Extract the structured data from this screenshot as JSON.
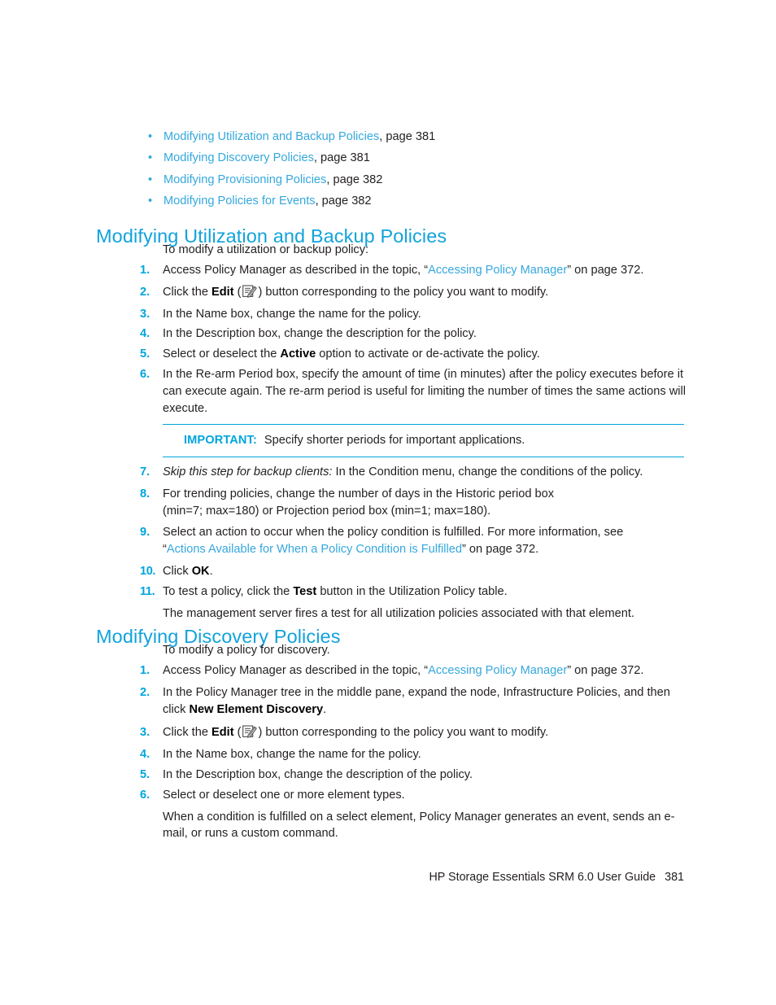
{
  "document": {
    "footer_title": "HP Storage Essentials SRM 6.0 User Guide",
    "page_number": "381"
  },
  "colors": {
    "heading": "#12a3dc",
    "link": "#35a8dd",
    "list_number": "#00a5dd",
    "rule": "#00a5dd",
    "body_text": "#231f20"
  },
  "cross_references": [
    {
      "link": "Modifying Utilization and Backup Policies",
      "tail": ", page 381"
    },
    {
      "link": "Modifying Discovery Policies",
      "tail": ", page 381"
    },
    {
      "link": "Modifying Provisioning Policies",
      "tail": ", page 382"
    },
    {
      "link": "Modifying Policies for Events",
      "tail": ", page 382"
    }
  ],
  "bullet_glyph": "•",
  "sections": {
    "utilization": {
      "heading": "Modifying Utilization and Backup Policies",
      "intro": "To modify a utilization or backup policy:",
      "steps": {
        "s1": {
          "num": "1.",
          "a": "Access Policy Manager as described in the topic, “",
          "link": "Accessing Policy Manager",
          "b": "” on page 372."
        },
        "s2": {
          "num": "2.",
          "a": "Click the ",
          "bold": "Edit",
          "b": " (",
          "c": ") button corresponding to the policy you want to modify."
        },
        "s3": {
          "num": "3.",
          "text": "In the Name box, change the name for the policy."
        },
        "s4": {
          "num": "4.",
          "text": "In the Description box, change the description for the policy."
        },
        "s5": {
          "num": "5.",
          "a": "Select or deselect the ",
          "bold": "Active",
          "b": " option to activate or de-activate the policy."
        },
        "s6": {
          "num": "6.",
          "text": "In the Re-arm Period box, specify the amount of time (in minutes) after the policy executes before it can execute again. The re-arm period is useful for limiting the number of times the same actions will execute."
        },
        "s7": {
          "num": "7.",
          "italic": "Skip this step for backup clients:",
          "b": " In the Condition menu, change the conditions of the policy."
        },
        "s8": {
          "num": "8.",
          "line1": "For trending policies, change the number of days in the Historic period box",
          "line2": "(min=7; max=180) or Projection period box (min=1; max=180)."
        },
        "s9": {
          "num": "9.",
          "line1": "Select an action to occur when the policy condition is fulfilled. For more information, see",
          "quote_open": "“",
          "link": "Actions Available for When a Policy Condition is Fulfilled",
          "quote_close": "” on page 372."
        },
        "s10": {
          "num": "10.",
          "a": "Click ",
          "bold": "OK",
          "b": "."
        },
        "s11": {
          "num": "11.",
          "a": "To test a policy, click the ",
          "bold": "Test",
          "b": " button in the Utilization Policy table.",
          "sub": "The management server fires a test for all utilization policies associated with that element."
        }
      },
      "admonition": {
        "label": "IMPORTANT:",
        "text": "Specify shorter periods for important applications."
      }
    },
    "discovery": {
      "heading": "Modifying Discovery Policies",
      "intro": "To modify a policy for discovery.",
      "steps": {
        "s1": {
          "num": "1.",
          "a": "Access Policy Manager as described in the topic, “",
          "link": "Accessing Policy Manager",
          "b": "” on page 372."
        },
        "s2": {
          "num": "2.",
          "a": "In the Policy Manager tree in the middle pane, expand the node, Infrastructure Policies, and then click ",
          "bold": "New Element Discovery",
          "b": "."
        },
        "s3": {
          "num": "3.",
          "a": "Click the ",
          "bold": "Edit",
          "b": " (",
          "c": ") button corresponding to the policy you want to modify."
        },
        "s4": {
          "num": "4.",
          "text": "In the Name box, change the name for the policy."
        },
        "s5": {
          "num": "5.",
          "text": "In the Description box, change the description of the policy."
        },
        "s6": {
          "num": "6.",
          "text": "Select or deselect one or more element types.",
          "sub": "When a condition is fulfilled on a select element, Policy Manager generates an event, sends an e-mail, or runs a custom command."
        }
      }
    }
  }
}
